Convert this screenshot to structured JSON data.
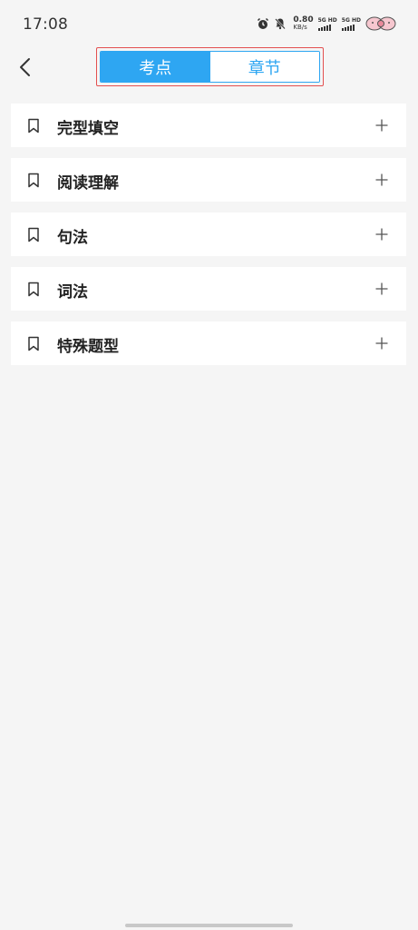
{
  "status_bar": {
    "time": "17:08",
    "net_speed_value": "0.80",
    "net_speed_unit": "KB/s",
    "sim1_label": "5G HD",
    "sim2_label": "5G HD",
    "icons": [
      "alarm-icon",
      "bell-muted-icon",
      "signal-icon",
      "signal-icon",
      "battery-icon"
    ]
  },
  "header": {
    "back_icon": "chevron-left-icon",
    "tabs": [
      {
        "label": "考点",
        "active": true
      },
      {
        "label": "章节",
        "active": false
      }
    ]
  },
  "categories": [
    {
      "label": "完型填空",
      "icon": "bookmark-icon",
      "action_icon": "plus-icon"
    },
    {
      "label": "阅读理解",
      "icon": "bookmark-icon",
      "action_icon": "plus-icon"
    },
    {
      "label": "句法",
      "icon": "bookmark-icon",
      "action_icon": "plus-icon"
    },
    {
      "label": "词法",
      "icon": "bookmark-icon",
      "action_icon": "plus-icon"
    },
    {
      "label": "特殊题型",
      "icon": "bookmark-icon",
      "action_icon": "plus-icon"
    }
  ],
  "colors": {
    "accent": "#2ea6f2",
    "highlight_border": "#e35050",
    "background": "#f5f5f5"
  }
}
